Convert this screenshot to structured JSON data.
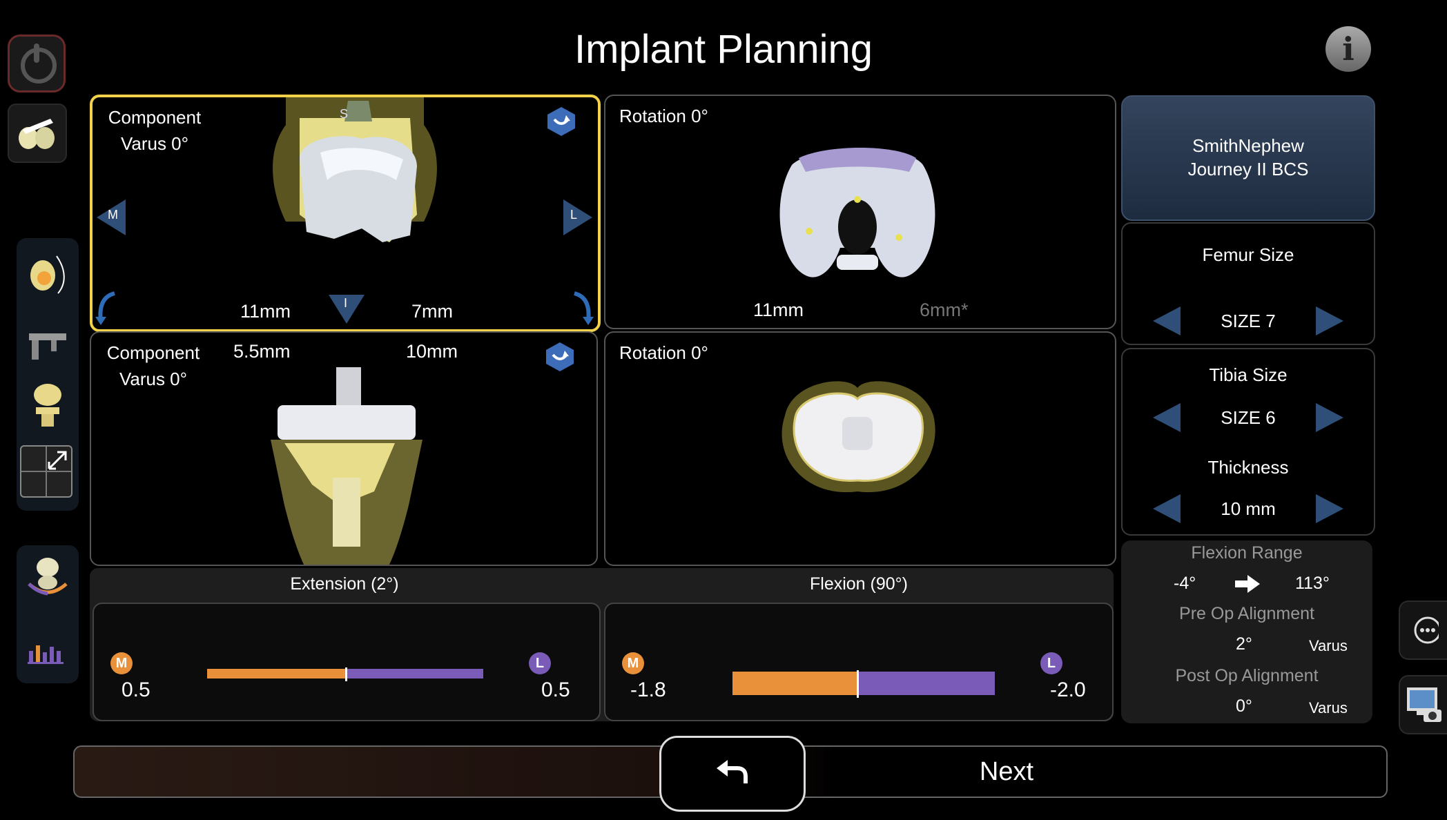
{
  "header": {
    "title": "Implant Planning",
    "info_glyph": "i"
  },
  "panels": {
    "femur_coronal": {
      "label1": "Component",
      "label2": "Varus 0°",
      "left_mm": "11mm",
      "right_mm": "7mm",
      "top_tag": "S",
      "bottom_tag": "I",
      "left_tag": "M",
      "right_tag": "L"
    },
    "femur_axial": {
      "label": "Rotation 0°",
      "left_mm": "11mm",
      "right_mm": "6mm*"
    },
    "tibia_coronal": {
      "label1": "Component",
      "label2": "Varus 0°",
      "left_mm": "5.5mm",
      "right_mm": "10mm"
    },
    "tibia_axial": {
      "label": "Rotation 0°"
    }
  },
  "balance": {
    "extension": {
      "title": "Extension (2°)",
      "m_tag": "M",
      "l_tag": "L",
      "m_value": "0.5",
      "l_value": "0.5",
      "m_gap": 0.5,
      "l_gap": 0.5
    },
    "flexion": {
      "title": "Flexion (90°)",
      "m_tag": "M",
      "l_tag": "L",
      "m_value": "-1.8",
      "l_value": "-2.0",
      "m_gap": -1.8,
      "l_gap": -2.0
    }
  },
  "implant": {
    "brand": "SmithNephew",
    "model": "Journey II BCS"
  },
  "femur": {
    "title": "Femur Size",
    "value": "SIZE 7"
  },
  "tibia": {
    "title": "Tibia Size",
    "value": "SIZE 6",
    "thickness_title": "Thickness",
    "thickness_value": "10 mm"
  },
  "stats": {
    "flexion_range_title": "Flexion Range",
    "flexion_from": "-4°",
    "flexion_to": "113°",
    "pre_op_title": "Pre Op Alignment",
    "pre_op_value": "2°",
    "pre_op_unit": "Varus",
    "post_op_title": "Post Op Alignment",
    "post_op_value": "0°",
    "post_op_unit": "Varus"
  },
  "footer": {
    "next_label": "Next"
  },
  "colors": {
    "accent_yellow": "#f2d24a",
    "medial_orange": "#e8903a",
    "lateral_purple": "#7a5cb8",
    "nav_blue": "#2f4f78"
  }
}
